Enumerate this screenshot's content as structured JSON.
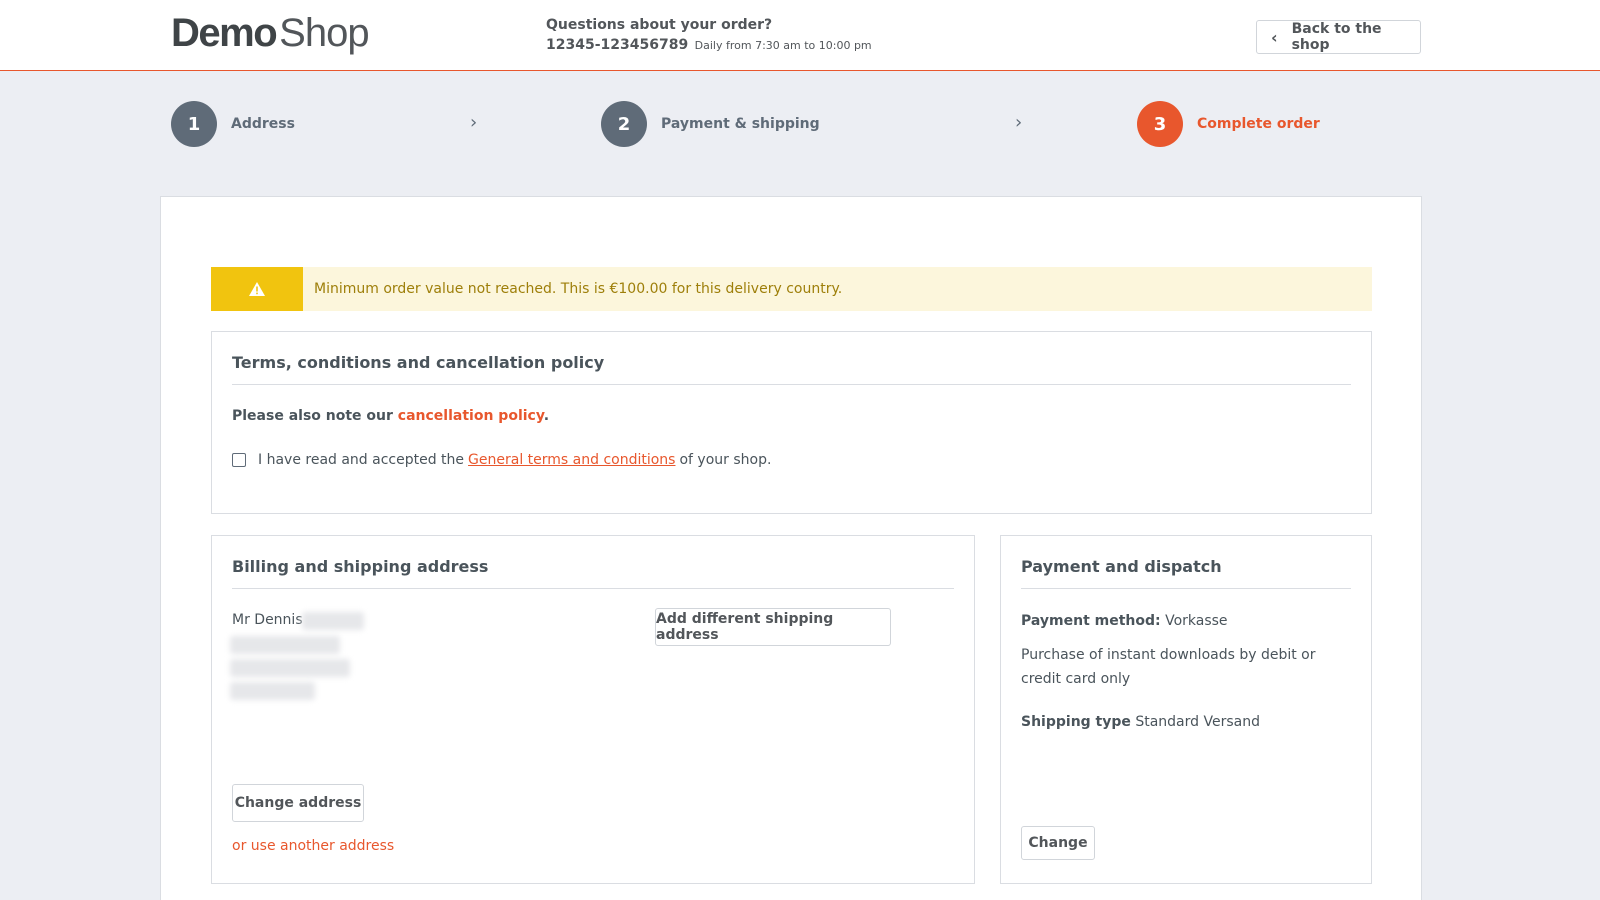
{
  "header": {
    "logo_bold": "Demo",
    "logo_light": "Shop",
    "contact_question": "Questions about your order?",
    "contact_phone": "12345-123456789",
    "contact_hours": "Daily from 7:30 am to 10:00 pm",
    "back_button": "Back to the shop"
  },
  "steps": [
    {
      "number": "1",
      "label": "Address"
    },
    {
      "number": "2",
      "label": "Payment & shipping"
    },
    {
      "number": "3",
      "label": "Complete order",
      "active": true
    }
  ],
  "alert": {
    "icon": "warning-icon",
    "text": "Minimum order value not reached. This is €100.00 for this delivery country."
  },
  "terms": {
    "title": "Terms, conditions and cancellation policy",
    "note_prefix": "Please also note our ",
    "note_link": "cancellation policy",
    "note_suffix": ".",
    "accept_prefix": "I have read and accepted the",
    "accept_link": "General terms and conditions",
    "accept_suffix": "of your shop."
  },
  "billing": {
    "title": "Billing and shipping address",
    "name": "Mr Dennis",
    "add_shipping_button": "Add different shipping address",
    "change_address_button": "Change address",
    "other_address_link": "or use another address"
  },
  "payment": {
    "title": "Payment and dispatch",
    "method_label": "Payment method:",
    "method_value": "Vorkasse",
    "method_note": "Purchase of instant downloads by debit or credit card only",
    "shipping_label": "Shipping type",
    "shipping_value": "Standard Versand",
    "change_button": "Change"
  },
  "colors": {
    "accent": "#e8572d",
    "warning": "#f1c40f",
    "step_inactive": "#5f6b78"
  }
}
